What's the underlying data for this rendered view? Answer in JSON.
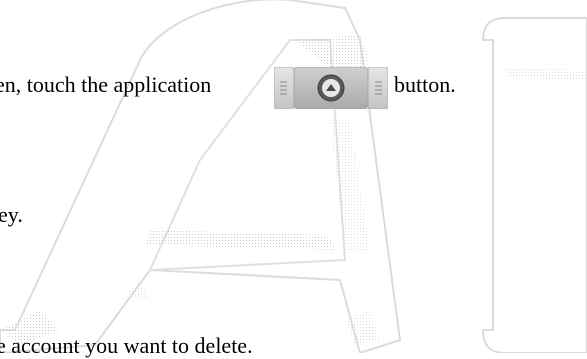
{
  "instructions": {
    "line1_prefix": "en, touch the application",
    "line1_suffix": "button.",
    "line2": "ey.",
    "line3": "e account you want to delete."
  },
  "icons": {
    "application_button": "app-launcher-up-arrow-icon",
    "watermark": "letters-watermark"
  },
  "colors": {
    "button_body": "#b9b9b9",
    "button_border": "#a6a6a6",
    "icon_fill": "#555555",
    "watermark_outline": "#d9d9d9"
  }
}
